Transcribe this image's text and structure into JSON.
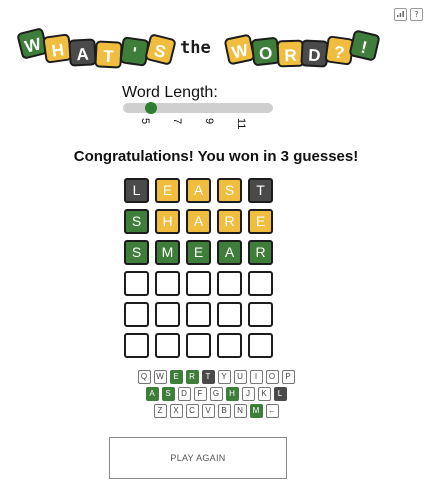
{
  "header": {
    "stats_icon": "bar-chart-icon",
    "help_label": "?"
  },
  "logo": {
    "tiles_left": [
      {
        "char": "W",
        "color": "green"
      },
      {
        "char": "H",
        "color": "yellow"
      },
      {
        "char": "A",
        "color": "dark"
      },
      {
        "char": "T",
        "color": "yellow"
      },
      {
        "char": "'",
        "color": "green"
      },
      {
        "char": "S",
        "color": "yellow"
      }
    ],
    "the_text": "the",
    "tiles_right": [
      {
        "char": "W",
        "color": "yellow"
      },
      {
        "char": "O",
        "color": "green"
      },
      {
        "char": "R",
        "color": "yellow"
      },
      {
        "char": "D",
        "color": "dark"
      },
      {
        "char": "?",
        "color": "yellow"
      },
      {
        "char": "!",
        "color": "green"
      }
    ]
  },
  "word_length": {
    "label": "Word Length:",
    "options": [
      "5",
      "7",
      "9",
      "11"
    ],
    "selected": "5"
  },
  "message": "Congratulations! You won in 3 guesses!",
  "board": {
    "rows": [
      [
        {
          "letter": "L",
          "state": "absent"
        },
        {
          "letter": "E",
          "state": "present"
        },
        {
          "letter": "A",
          "state": "present"
        },
        {
          "letter": "S",
          "state": "present"
        },
        {
          "letter": "T",
          "state": "absent"
        }
      ],
      [
        {
          "letter": "S",
          "state": "correct"
        },
        {
          "letter": "H",
          "state": "present"
        },
        {
          "letter": "A",
          "state": "present"
        },
        {
          "letter": "R",
          "state": "present"
        },
        {
          "letter": "E",
          "state": "present"
        }
      ],
      [
        {
          "letter": "S",
          "state": "correct"
        },
        {
          "letter": "M",
          "state": "correct"
        },
        {
          "letter": "E",
          "state": "correct"
        },
        {
          "letter": "A",
          "state": "correct"
        },
        {
          "letter": "R",
          "state": "correct"
        }
      ],
      [
        {
          "letter": "",
          "state": "empty"
        },
        {
          "letter": "",
          "state": "empty"
        },
        {
          "letter": "",
          "state": "empty"
        },
        {
          "letter": "",
          "state": "empty"
        },
        {
          "letter": "",
          "state": "empty"
        }
      ],
      [
        {
          "letter": "",
          "state": "empty"
        },
        {
          "letter": "",
          "state": "empty"
        },
        {
          "letter": "",
          "state": "empty"
        },
        {
          "letter": "",
          "state": "empty"
        },
        {
          "letter": "",
          "state": "empty"
        }
      ],
      [
        {
          "letter": "",
          "state": "empty"
        },
        {
          "letter": "",
          "state": "empty"
        },
        {
          "letter": "",
          "state": "empty"
        },
        {
          "letter": "",
          "state": "empty"
        },
        {
          "letter": "",
          "state": "empty"
        }
      ]
    ]
  },
  "keyboard": {
    "rows": [
      [
        {
          "k": "Q",
          "s": "none"
        },
        {
          "k": "W",
          "s": "none"
        },
        {
          "k": "E",
          "s": "correct"
        },
        {
          "k": "R",
          "s": "correct"
        },
        {
          "k": "T",
          "s": "absent"
        },
        {
          "k": "Y",
          "s": "none"
        },
        {
          "k": "U",
          "s": "none"
        },
        {
          "k": "I",
          "s": "none"
        },
        {
          "k": "O",
          "s": "none"
        },
        {
          "k": "P",
          "s": "none"
        }
      ],
      [
        {
          "k": "A",
          "s": "correct"
        },
        {
          "k": "S",
          "s": "correct"
        },
        {
          "k": "D",
          "s": "none"
        },
        {
          "k": "F",
          "s": "none"
        },
        {
          "k": "G",
          "s": "none"
        },
        {
          "k": "H",
          "s": "correct"
        },
        {
          "k": "J",
          "s": "none"
        },
        {
          "k": "K",
          "s": "none"
        },
        {
          "k": "L",
          "s": "absent"
        }
      ],
      [
        {
          "k": "Z",
          "s": "none"
        },
        {
          "k": "X",
          "s": "none"
        },
        {
          "k": "C",
          "s": "none"
        },
        {
          "k": "V",
          "s": "none"
        },
        {
          "k": "B",
          "s": "none"
        },
        {
          "k": "N",
          "s": "none"
        },
        {
          "k": "M",
          "s": "correct"
        },
        {
          "k": "←",
          "s": "none"
        }
      ]
    ]
  },
  "play_again_label": "PLAY AGAIN",
  "colors": {
    "green": "#3f7d3b",
    "yellow": "#f0bd3e",
    "dark": "#4a4a4a",
    "slider_thumb": "#2f7d32"
  }
}
